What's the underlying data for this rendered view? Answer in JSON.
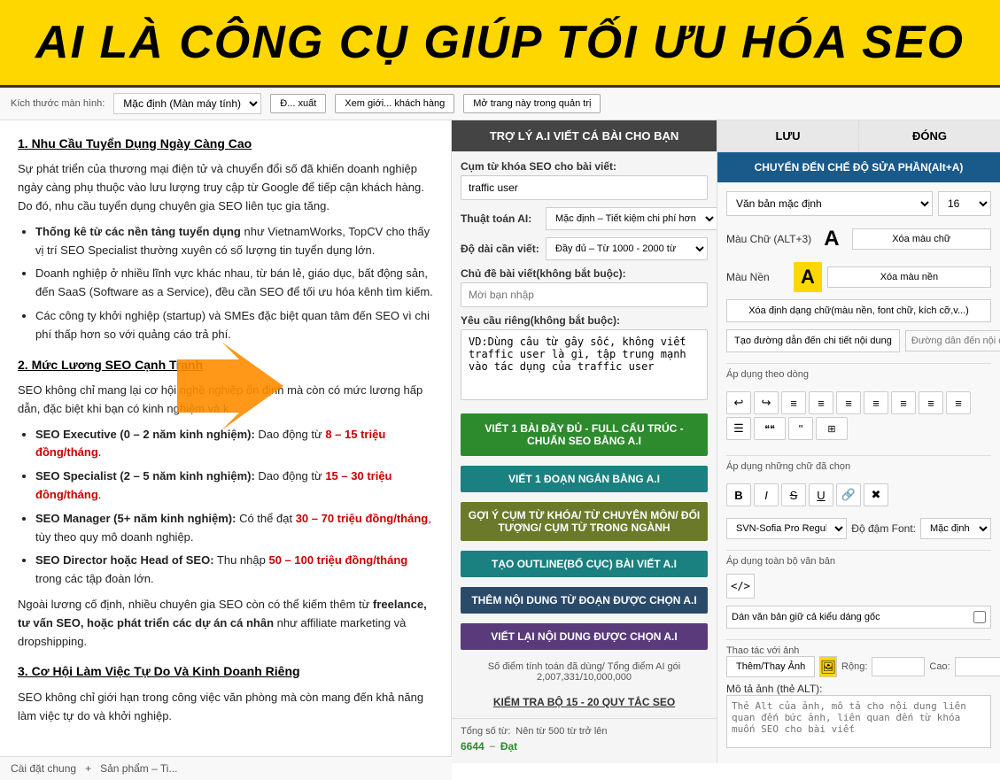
{
  "header": {
    "title": "AI LÀ CÔNG CỤ GIÚP TỐI ƯU HÓA SEO"
  },
  "toolbar": {
    "screen_size_label": "Kích thước màn hình:",
    "screen_size_value": "Mặc định (Màn máy tính)",
    "export_btn": "Đ... xuất",
    "preview_btn": "Xem giới... khách hàng",
    "manage_btn": "Mở trang này trong quản trị"
  },
  "article": {
    "sections": [
      {
        "heading": "1. Nhu Cầu Tuyển Dụng Ngày Càng Cao",
        "paragraphs": [
          "Sự phát triển của thương mại điện tử và chuyển đổi số đã khiến doanh nghiệp ngày càng phụ thuộc vào lưu lượng truy cập từ Google để tiếp cận khách hàng. Do đó, nhu cầu tuyển dụng chuyên gia SEO liên tục gia tăng.",
          ""
        ],
        "bullets": [
          "Thống kê từ các nền tảng tuyển dụng như VietnamWorks, TopCV cho thấy vị trí SEO Specialist thường xuyên có số lượng tin tuyển dụng lớn.",
          "Doanh nghiệp ở nhiều lĩnh vực khác nhau, từ bán lẻ, giáo dục, bất động sản, đến SaaS (Software as a Service), đều cần SEO để tối ưu hóa kênh tìm kiếm.",
          "Các công ty khởi nghiệp (startup) và SMEs đặc biệt quan tâm đến SEO vì chi phí thấp hơn so với quảng cáo trả phí."
        ]
      },
      {
        "heading": "2. Mức Lương SEO Cạnh Tranh",
        "paragraphs": [
          "SEO không chỉ mang lại cơ hội nghề nghiệp ổn định mà còn có mức lương hấp dẫn, đặc biệt khi bạn có kinh nghiệm và kỹ năng chuyên sâu."
        ],
        "bullets": [
          "SEO Executive (0 – 2 năm kinh nghiệm): Dao động từ 8 – 15 triệu đồng/tháng.",
          "SEO Specialist (2 – 5 năm kinh nghiệm): Dao động từ 15 – 30 triệu đồng/tháng.",
          "SEO Manager (5+ năm kinh nghiệm): Có thể đạt 30 – 70 triệu đồng/tháng, tùy theo quy mô doanh nghiệp.",
          "SEO Director hoặc Head of SEO: Thu nhập 50 – 100 triệu đồng/tháng trong các tập đoàn lớn."
        ]
      },
      {
        "heading": "",
        "paragraphs": [
          "Ngoài lương cố định, nhiều chuyên gia SEO còn có thể kiếm thêm từ freelance, tư vấn SEO, hoặc phát triển các dự án cá nhân như affiliate marketing và dropshipping."
        ]
      },
      {
        "heading": "3. Cơ Hội Làm Việc Tự Do Và Kinh Doanh Riêng",
        "paragraphs": [
          "SEO không chỉ giới hạn trong công việc văn phòng mà còn mang đến khả năng làm việc tự do và khởi nghiệp."
        ]
      }
    ],
    "bottom_tabs": [
      "Cài đặt chung",
      "+",
      "Sản phẩm – Ti..."
    ]
  },
  "ai_panel": {
    "header": "TRỢ LÝ A.I VIẾT CÁ BÀI CHO BẠN",
    "keyword_label": "Cụm từ khóa SEO cho bài viết:",
    "keyword_value": "traffic user",
    "ai_method_label": "Thuật toán AI:",
    "ai_method_value": "Mặc định – Tiết kiệm chi phí hơn",
    "length_label": "Độ dài cần viết:",
    "length_value": "Đầy đủ – Từ 1000 - 2000 từ",
    "subject_label": "Chủ đề bài viết(không bắt buộc):",
    "subject_placeholder": "Mời bạn nhập",
    "requirement_label": "Yêu cầu riêng(không bắt buộc):",
    "requirement_placeholder": "VD:Dùng câu từ gây sốc, không viết traffic user là gì, tập trung mạnh vào tác dụng của traffic user",
    "btn_full": "VIẾT 1 BÀI ĐẦY ĐỦ - FULL CẤU TRÚC - CHUẨN SEO BẰNG A.I",
    "btn_short": "VIẾT 1 ĐOẠN NGẮN BẰNG A.I",
    "btn_suggest": "GỢI Ý CỤM TỪ KHÓA/ TỪ CHUYÊN MÔN/ ĐỐI TƯỢNG/ CỤM TỪ TRONG NGÀNH",
    "btn_outline": "TẠO OUTLINE(BỐ CỤC) BÀI VIẾT A.I",
    "btn_add_content": "THÊM NỘI DUNG TỪ ĐOẠN ĐƯỢC CHỌN A.I",
    "btn_rewrite": "VIẾT LẠI NỘI DUNG ĐƯỢC CHỌN A.I",
    "stats_label": "Số điểm tính toán đã dùng/ Tổng điểm AI gói",
    "stats_value": "2,007,331/10,000,000",
    "seo_check": "KIỂM TRA BỘ 15 - 20 QUY TẮC SEO",
    "footer_word_count_label": "Tổng số từ:",
    "footer_word_count_target": "Nên từ 500 từ trở lên",
    "footer_word_count_value": "6644",
    "footer_word_count_status": "Đạt"
  },
  "settings_panel": {
    "btn_save": "LƯU",
    "btn_close": "ĐÓNG",
    "btn_switch": "CHUYỂN ĐẾN CHẾ ĐỘ SỬA PHẦN(Alt+A)",
    "font_type_label": "Văn bản mặc định",
    "font_size_value": "16",
    "font_color_label": "Màu Chữ (ALT+3)",
    "font_color_preview": "A",
    "clear_color_btn": "Xóa màu chữ",
    "bg_color_label": "Màu Nền",
    "bg_color_preview": "A",
    "clear_bg_btn": "Xóa màu nền",
    "delete_formatting_btn": "Xóa định dạng chữ(màu nền, font chữ, kích cỡ,v...)",
    "create_link_btn": "Tạo đường dẫn đến chi tiết nội dung",
    "create_link_placeholder": "Đường dẫn đến nội dung nếu có",
    "apply_section_label": "Áp dụng theo dòng",
    "format_btns": [
      "↩",
      "↪",
      "≡",
      "≡",
      "≡",
      "≡",
      "≡",
      "≡",
      "≡",
      "☰",
      "❝❝",
      "\"",
      "⊞"
    ],
    "apply_selected_label": "Áp dụng những chữ đã chọn",
    "text_format_btns": [
      "B",
      "I",
      "S",
      "U",
      "🔗",
      "✖"
    ],
    "font_select_label": "SVN-Sofia Pro Regular",
    "font_weight_label": "Độ đậm Font:",
    "font_weight_value": "Mặc định",
    "apply_all_label": "Áp dụng toàn bộ văn bản",
    "code_btn": "</>",
    "paste_label": "Dán văn bản giữ cả kiểu dáng gốc",
    "image_section_label": "Thao tác với ảnh",
    "add_image_btn": "Thêm/Thay Ảnh",
    "width_label": "Rộng:",
    "height_label": "Cao:",
    "alt_label": "Mô tả ảnh (thẻ ALT):",
    "alt_placeholder": "Thẻ Alt của ảnh, mô tả cho nội dung liên quan đến bức ảnh, liên quan đến từ khóa muốn SEO cho bài viết"
  }
}
